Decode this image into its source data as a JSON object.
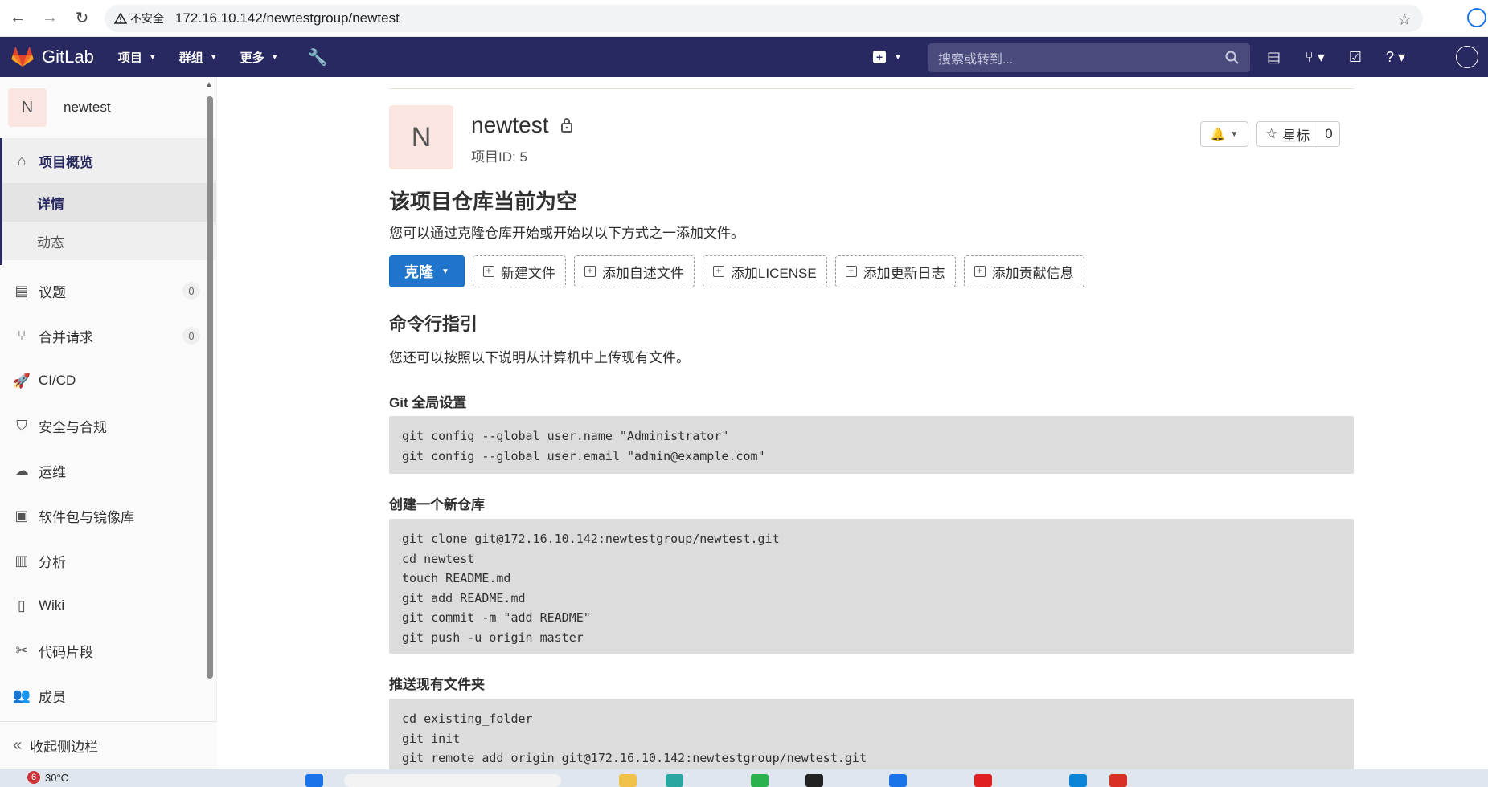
{
  "browser": {
    "insecure_label": "不安全",
    "url": "172.16.10.142/newtestgroup/newtest"
  },
  "navbar": {
    "brand": "GitLab",
    "menu": [
      "项目",
      "群组",
      "更多"
    ],
    "search_placeholder": "搜索或转到..."
  },
  "sidebar": {
    "project_initial": "N",
    "project_name": "newtest",
    "overview_label": "项目概览",
    "sub_items": [
      "详情",
      "动态"
    ],
    "items": [
      {
        "label": "议题",
        "count": "0"
      },
      {
        "label": "合并请求",
        "count": "0"
      },
      {
        "label": "CI/CD"
      },
      {
        "label": "安全与合规"
      },
      {
        "label": "运维"
      },
      {
        "label": "软件包与镜像库"
      },
      {
        "label": "分析"
      },
      {
        "label": "Wiki"
      },
      {
        "label": "代码片段"
      },
      {
        "label": "成员"
      }
    ],
    "collapse_label": "收起侧边栏"
  },
  "project": {
    "initial": "N",
    "name": "newtest",
    "id_label": "项目ID: 5",
    "star_label": "星标",
    "star_count": "0"
  },
  "empty": {
    "title": "该项目仓库当前为空",
    "desc": "您可以通过克隆仓库开始或开始以以下方式之一添加文件。"
  },
  "actions": {
    "clone": "克隆",
    "buttons": [
      "新建文件",
      "添加自述文件",
      "添加LICENSE",
      "添加更新日志",
      "添加贡献信息"
    ]
  },
  "cli": {
    "title": "命令行指引",
    "desc": "您还可以按照以下说明从计算机中上传现有文件。",
    "sections": [
      {
        "heading": "Git 全局设置",
        "code": "git config --global user.name \"Administrator\"\ngit config --global user.email \"admin@example.com\""
      },
      {
        "heading": "创建一个新仓库",
        "code": "git clone git@172.16.10.142:newtestgroup/newtest.git\ncd newtest\ntouch README.md\ngit add README.md\ngit commit -m \"add README\"\ngit push -u origin master"
      },
      {
        "heading": "推送现有文件夹",
        "code": "cd existing_folder\ngit init\ngit remote add origin git@172.16.10.142:newtestgroup/newtest.git"
      }
    ]
  },
  "taskbar": {
    "notification_count": "6",
    "temperature": "30°C"
  },
  "colors": {
    "navbar": "#292961",
    "primary_button": "#1f75cb",
    "code_bg": "#dcdcdc"
  }
}
